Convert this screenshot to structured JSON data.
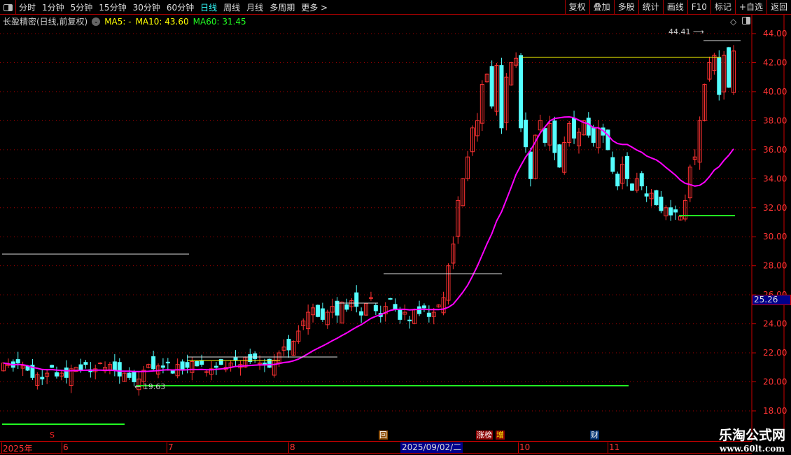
{
  "toolbar": {
    "tabs": [
      "分时",
      "1分钟",
      "5分钟",
      "15分钟",
      "30分钟",
      "60分钟",
      "日线",
      "周线",
      "月线",
      "多周期",
      "更多 >"
    ],
    "active_tab": "日线",
    "buttons": [
      "复权",
      "叠加",
      "多股",
      "统计",
      "画线",
      "F10",
      "标记",
      "+自选",
      "返回"
    ]
  },
  "legend": {
    "title": "长盈精密(日线,前复权)",
    "ma5": "MA5: -",
    "ma10": "MA10: 43.60",
    "ma60": "MA60: 31.45"
  },
  "price_axis": {
    "ticks": [
      "44.00",
      "42.00",
      "40.00",
      "38.00",
      "36.00",
      "34.00",
      "32.00",
      "30.00",
      "28.00",
      "26.00",
      "24.00",
      "22.00",
      "20.00",
      "18.00"
    ],
    "current_price": "25.26"
  },
  "annotations": {
    "high": "44.41",
    "low": "19.63"
  },
  "markers": [
    {
      "text": "S",
      "color": "#f22",
      "bg": "#000"
    },
    {
      "text": "回",
      "color": "#fff",
      "bg": "#8b4a00"
    },
    {
      "text": "涨榜",
      "color": "#fff",
      "bg": "#8b0000"
    },
    {
      "text": "增",
      "color": "#ff0",
      "bg": "#8b0000"
    },
    {
      "text": "财",
      "color": "#fff",
      "bg": "#003070"
    }
  ],
  "date_axis": {
    "labels": [
      "2025年",
      "6",
      "7",
      "8",
      "10",
      "11"
    ],
    "selected_date": "2025/09/02/二"
  },
  "watermark": {
    "name": "乐淘公式网",
    "url": "www.60lt.com"
  },
  "colors": {
    "up": "#ff3232",
    "down": "#54ffff",
    "ma": "#ff00ff"
  },
  "closes": [
    21.3,
    21.2,
    21.0,
    21.3,
    21.1,
    20.8,
    20.3,
    20.5,
    20.2,
    20.6,
    21.0,
    20.4,
    20.6,
    20.3,
    20.9,
    21.0,
    20.8,
    21.2,
    20.7,
    20.9,
    21.3,
    21.0,
    21.2,
    20.8,
    20.4,
    20.6,
    20.3,
    20.0,
    20.2,
    20.8,
    21.2,
    20.9,
    21.1,
    21.0,
    21.3,
    20.6,
    21.2,
    20.8,
    21.0,
    21.4,
    21.1,
    21.2,
    20.7,
    20.9,
    21.0,
    21.2,
    21.0,
    21.3,
    21.5,
    21.2,
    21.7,
    21.4,
    21.6,
    21.3,
    21.2,
    21.0,
    21.5,
    22.0,
    22.4,
    22.2,
    22.8,
    23.5,
    24.2,
    24.8,
    25.1,
    24.5,
    24.3,
    24.8,
    25.2,
    24.6,
    25.5,
    25.0,
    25.6,
    25.2,
    24.6,
    25.4,
    25.8,
    24.9,
    24.5,
    25.2,
    25.7,
    25.0,
    24.3,
    24.8,
    24.2,
    25.0,
    24.7,
    25.1,
    24.5,
    24.8,
    25.3,
    25.8,
    28.0,
    29.5,
    32.5,
    34.0,
    35.5,
    37.5,
    38.0,
    40.5,
    41.2,
    39.0,
    41.8,
    37.5,
    41.0,
    42.0,
    42.3,
    37.5,
    36.2,
    34.0,
    37.0,
    38.0,
    36.5,
    37.8,
    35.8,
    34.8,
    36.5,
    37.8,
    36.8,
    37.2,
    38.0,
    37.0,
    36.5,
    37.5,
    37.0,
    36.0,
    34.5,
    33.5,
    35.0,
    34.0,
    33.2,
    34.0,
    33.5,
    32.8,
    33.0,
    32.2,
    31.8,
    32.0,
    31.5,
    31.7,
    31.4,
    32.5,
    34.8,
    35.5,
    38.0,
    40.5,
    42.0,
    42.5,
    39.8,
    42.5,
    40.3,
    42.8
  ]
}
